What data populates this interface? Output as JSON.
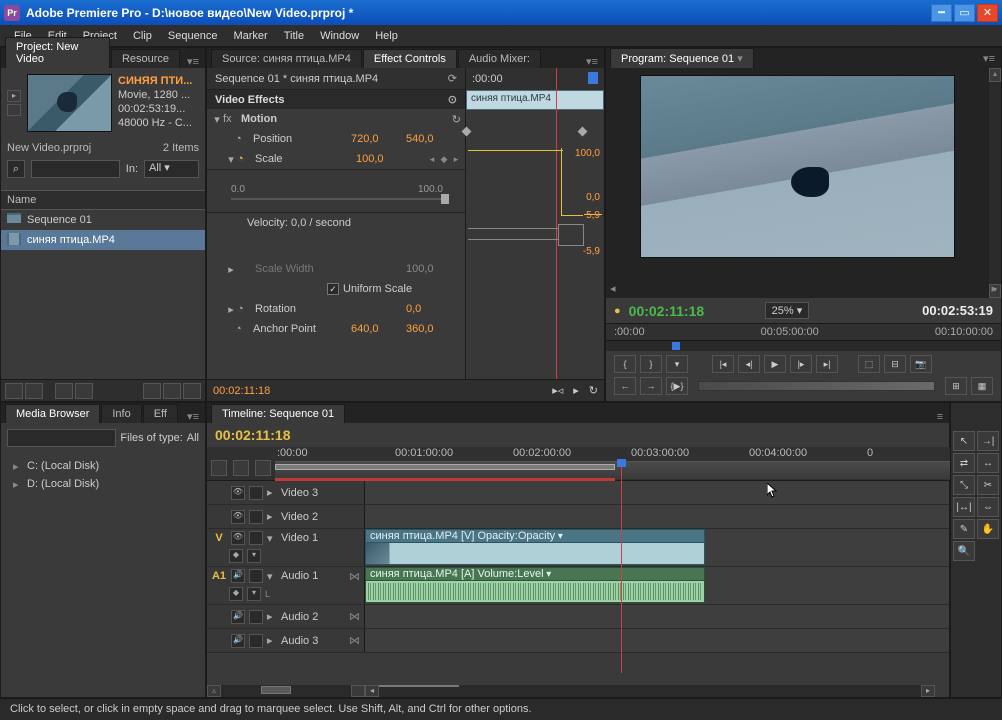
{
  "window": {
    "title": "Adobe Premiere Pro - D:\\новое видео\\New Video.prproj *"
  },
  "menu": {
    "items": [
      "File",
      "Edit",
      "Project",
      "Clip",
      "Sequence",
      "Marker",
      "Title",
      "Window",
      "Help"
    ]
  },
  "project": {
    "tab": "Project: New Video",
    "tab2": "Resource",
    "clip": {
      "name": "СИНЯЯ ПТИ...",
      "line1": "Movie, 1280 ...",
      "line2": "00:02:53:19...",
      "line3": "48000 Hz - C..."
    },
    "file_label": "New Video.prproj",
    "items_count": "2 Items",
    "in_label": "In:",
    "in_value": "All",
    "name_col": "Name",
    "bin_items": [
      "Sequence 01",
      "синяя птица.MP4"
    ]
  },
  "effect_controls": {
    "tab_source": "Source: синяя птица.MP4",
    "tab_ec": "Effect Controls",
    "tab_mixer": "Audio Mixer:",
    "header": "Sequence 01 * синяя птица.MP4",
    "timeline_start": ":00:00",
    "clip_label": "синяя птица.MP4",
    "section_video": "Video Effects",
    "motion_label": "Motion",
    "position_label": "Position",
    "position_x": "720,0",
    "position_y": "540,0",
    "scale_label": "Scale",
    "scale_val": "100,0",
    "scale_min": "0.0",
    "scale_max": "100.0",
    "scale_kf1": "100,0",
    "scale_kf2": "0,0",
    "vel_pos": "5,9",
    "vel_neg": "-5,9",
    "velocity_label": "Velocity: 0,0 / second",
    "scale_width_label": "Scale Width",
    "scale_width_val": "100,0",
    "uniform_label": "Uniform Scale",
    "rotation_label": "Rotation",
    "rotation_val": "0,0",
    "anchor_label": "Anchor Point",
    "anchor_x": "640,0",
    "anchor_y": "360,0",
    "bottom_tc": "00:02:11:18"
  },
  "program": {
    "tab": "Program: Sequence 01",
    "cur_tc": "00:02:11:18",
    "zoom": "25%",
    "dur_tc": "00:02:53:19",
    "ruler": [
      ":00:00",
      "00:05:00:00",
      "00:10:00:00"
    ]
  },
  "media": {
    "tab_browser": "Media Browser",
    "tab_info": "Info",
    "tab_eff": "Eff",
    "filter_label": "Files of type:",
    "filter_val": "All",
    "drives": [
      "C: (Local Disk)",
      "D: (Local Disk)"
    ]
  },
  "timeline": {
    "tab": "Timeline: Sequence 01",
    "cur_tc": "00:02:11:18",
    "ruler": [
      ":00:00",
      "00:01:00:00",
      "00:02:00:00",
      "00:03:00:00",
      "00:04:00:00",
      "0"
    ],
    "tracks": {
      "v3": "Video 3",
      "v2": "Video 2",
      "v1": "Video 1",
      "a1": "Audio 1",
      "a2": "Audio 2",
      "a3": "Audio 3"
    },
    "v_target": "V",
    "a_target": "A1",
    "v1_clip_label": "синяя птица.MP4 [V]  Opacity:Opacity",
    "a1_clip_label": "синяя птица.MP4 [A]  Volume:Level"
  },
  "status": "Click to select, or click in empty space and drag to marquee select. Use Shift, Alt, and Ctrl for other options."
}
